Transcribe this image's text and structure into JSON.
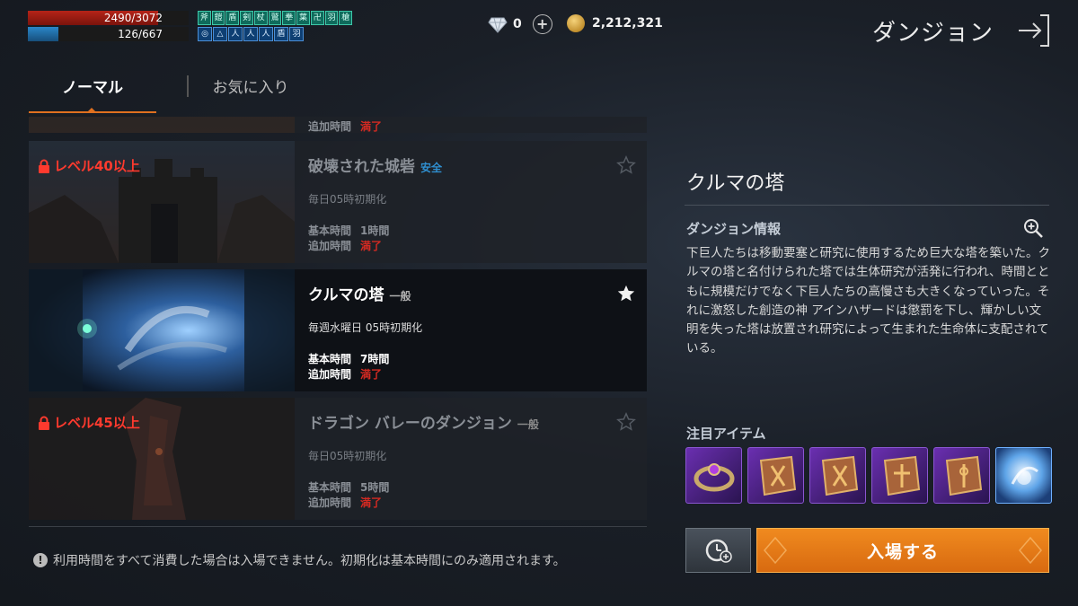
{
  "status": {
    "hp_text": "2490/3072",
    "hp_fraction": 0.81,
    "mp_text": "126/667",
    "mp_fraction": 0.19,
    "buffs_row1": [
      "斧",
      "鎧",
      "盾",
      "剣",
      "杖",
      "鷲",
      "拳",
      "葉",
      "卍",
      "羽",
      "槍"
    ],
    "buffs_row2": [
      "◎",
      "△",
      "人",
      "人",
      "人",
      "盾",
      "羽"
    ]
  },
  "currency": {
    "gems": "0",
    "gold": "2,212,321"
  },
  "header": {
    "title": "ダンジョン"
  },
  "tabs": [
    {
      "label": "ノーマル",
      "active": true
    },
    {
      "label": "お気に入り",
      "active": false
    }
  ],
  "dungeons": [
    {
      "name": "破壊された城砦",
      "tag": "安全",
      "tag_type": "safe",
      "lock": "レベル40以上",
      "reset": "毎日05時初期化",
      "base_label": "基本時間",
      "base_value": "1時間",
      "extra_label": "追加時間",
      "extra_value": "満了",
      "favorite": false
    },
    {
      "name": "クルマの塔",
      "tag": "一般",
      "tag_type": "normal",
      "lock": "",
      "reset": "毎週水曜日 05時初期化",
      "base_label": "基本時間",
      "base_value": "7時間",
      "extra_label": "追加時間",
      "extra_value": "満了",
      "favorite": true
    },
    {
      "name": "ドラゴン バレーのダンジョン",
      "tag": "一般",
      "tag_type": "normal",
      "lock": "レベル45以上",
      "reset": "毎日05時初期化",
      "base_label": "基本時間",
      "base_value": "5時間",
      "extra_label": "追加時間",
      "extra_value": "満了",
      "favorite": false
    }
  ],
  "partial_card": {
    "extra_label": "追加時間",
    "extra_value": "満了"
  },
  "notice": "利用時間をすべて消費した場合は入場できません。初期化は基本時間にのみ適用されます。",
  "detail": {
    "title": "クルマの塔",
    "info_heading": "ダンジョン情報",
    "description": "下巨人たちは移動要塞と研究に使用するため巨大な塔を築いた。クルマの塔と名付けられた塔では生体研究が活発に行われ、時間とともに規模だけでなく下巨人たちの高慢さも大きくなっていった。それに激怒した創造の神 アインハザードは懲罰を下し、輝かしい文明を失った塔は放置され研究によって生まれた生命体に支配されている。",
    "items_heading": "注目アイテム",
    "items": [
      "ring-item-icon",
      "book-item-icon",
      "book-item-icon",
      "book-item-icon",
      "book-item-icon",
      "orb-item-icon"
    ],
    "enter_label": "入場する"
  },
  "colors": {
    "accent": "#e0701f",
    "lock_red": "#ff3a2e",
    "safe_blue": "#2f8fd0",
    "expired_red": "#d32a22"
  }
}
